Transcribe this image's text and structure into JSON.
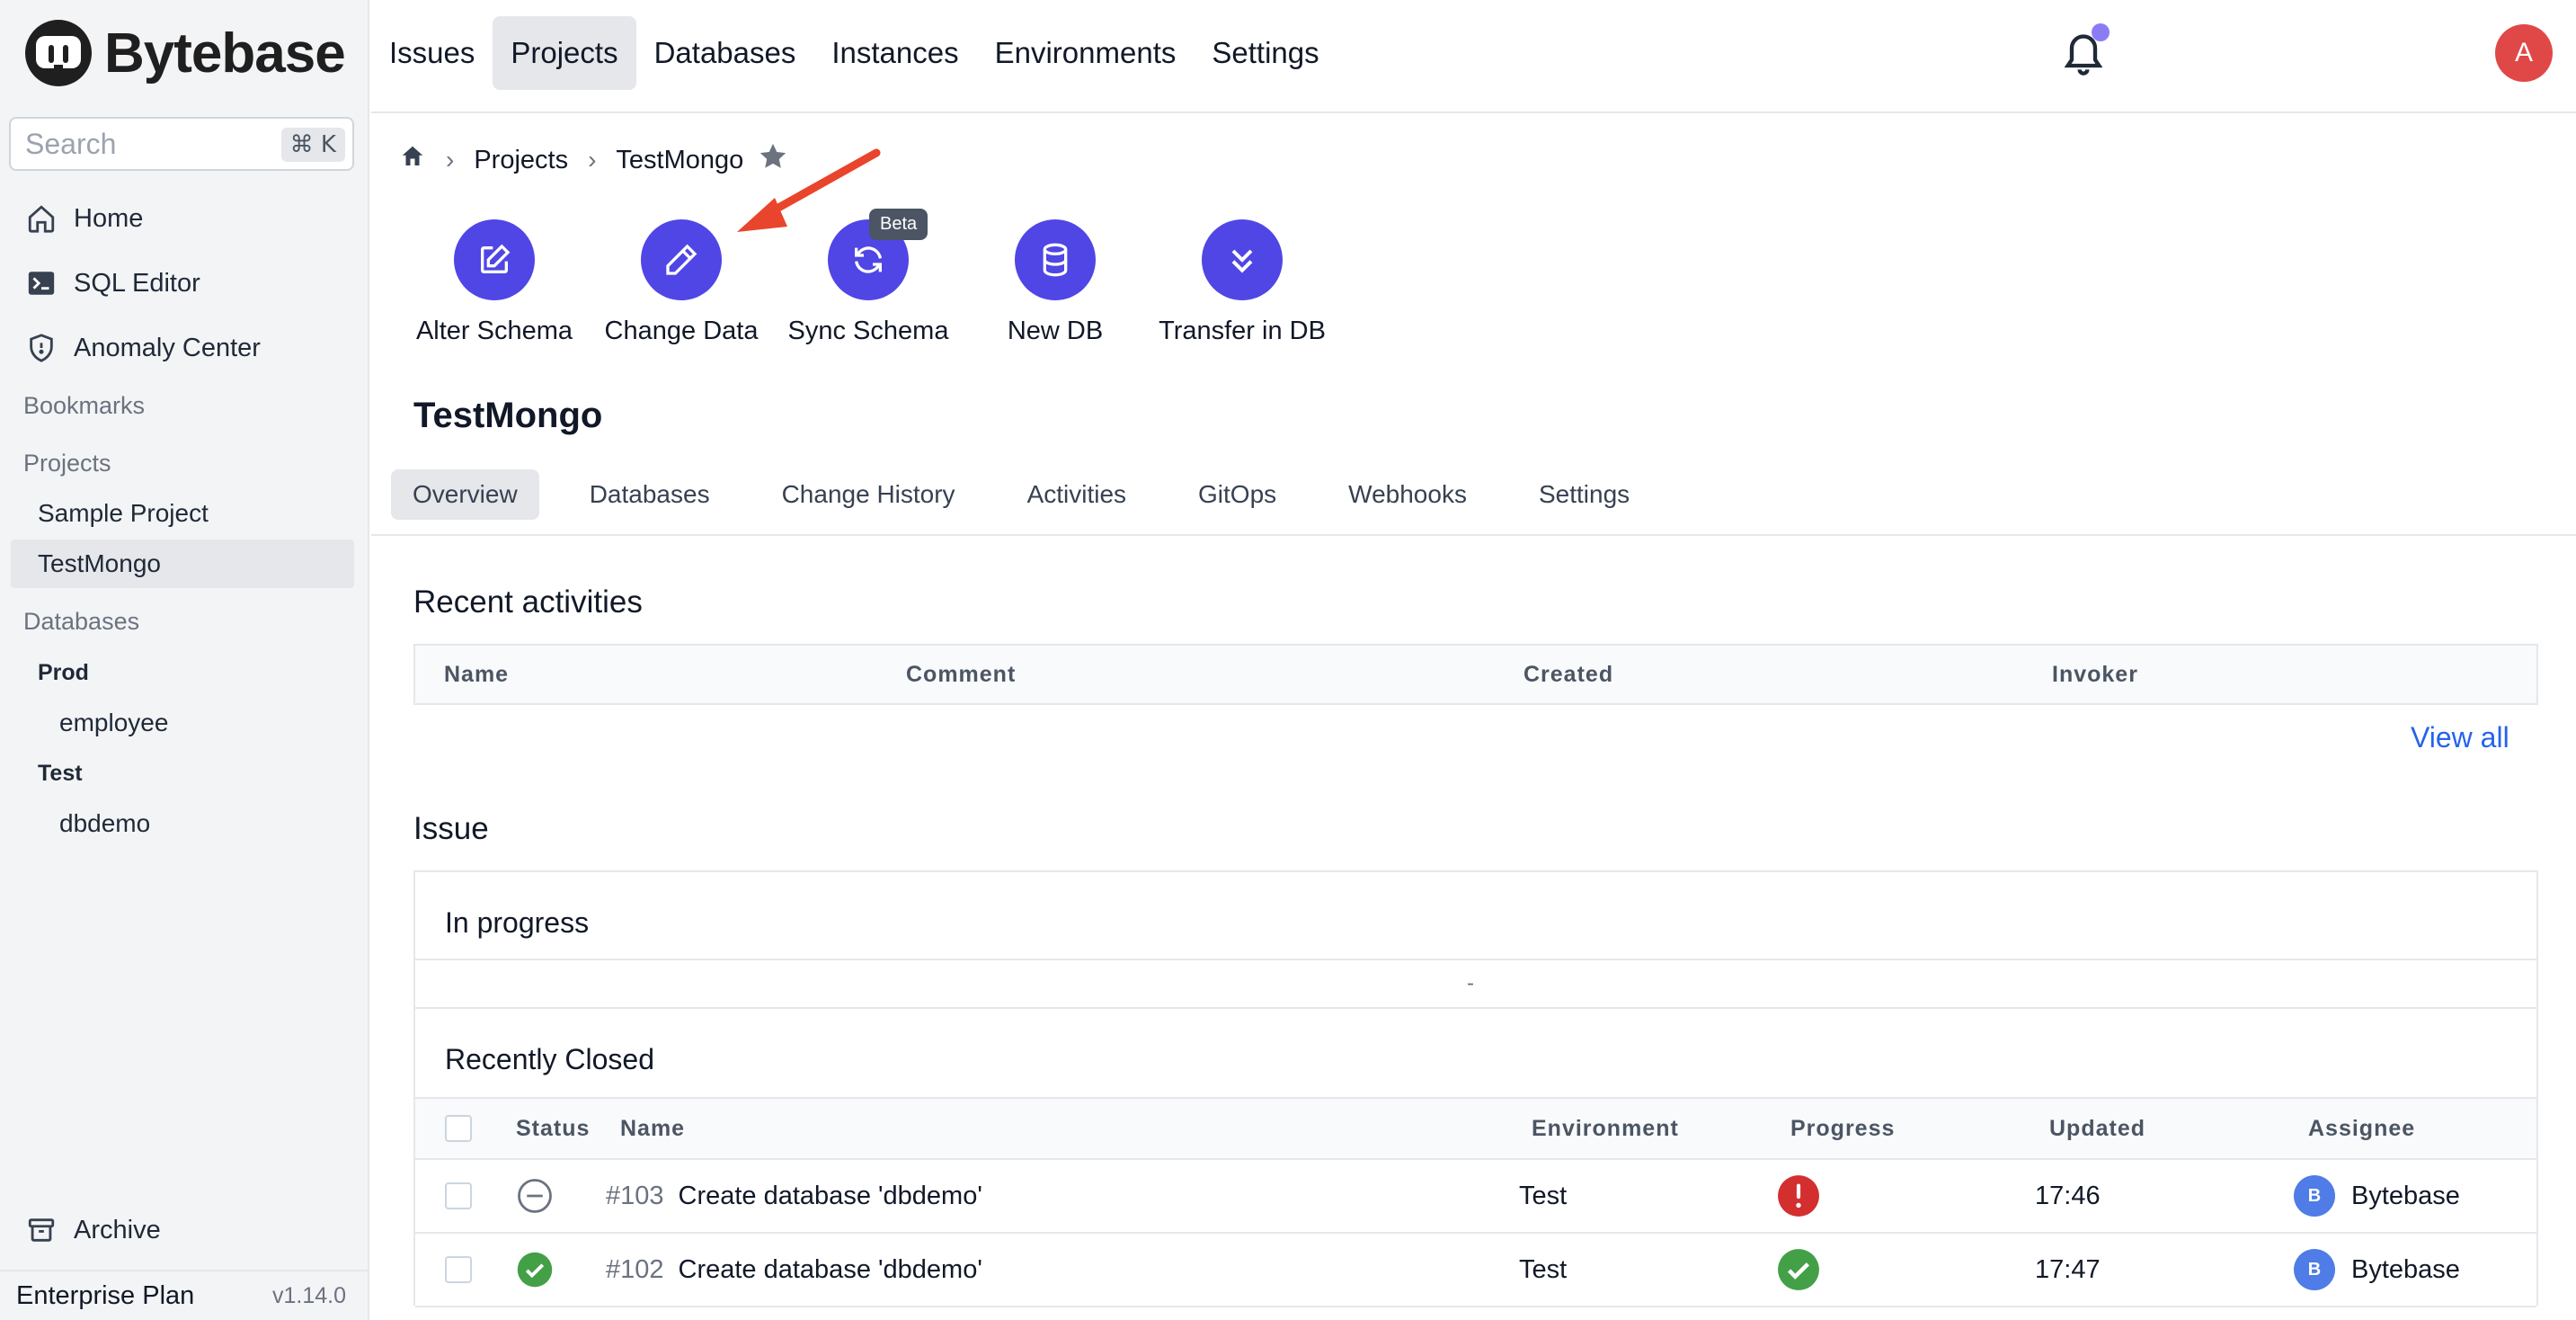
{
  "app": {
    "name": "Bytebase",
    "plan": "Enterprise Plan",
    "version": "v1.14.0"
  },
  "search": {
    "placeholder": "Search",
    "shortcut": "⌘ K"
  },
  "sidebar": {
    "nav": [
      {
        "label": "Home",
        "icon": "home-icon"
      },
      {
        "label": "SQL Editor",
        "icon": "terminal-icon"
      },
      {
        "label": "Anomaly Center",
        "icon": "shield-icon"
      }
    ],
    "bookmarks_label": "Bookmarks",
    "projects_label": "Projects",
    "projects": [
      {
        "label": "Sample Project",
        "active": false
      },
      {
        "label": "TestMongo",
        "active": true
      }
    ],
    "databases_label": "Databases",
    "environments": [
      {
        "label": "Prod",
        "databases": [
          "employee"
        ]
      },
      {
        "label": "Test",
        "databases": [
          "dbdemo"
        ]
      }
    ],
    "archive_label": "Archive"
  },
  "header": {
    "nav": [
      "Issues",
      "Projects",
      "Databases",
      "Instances",
      "Environments",
      "Settings"
    ],
    "active_nav": "Projects",
    "avatar_initial": "A"
  },
  "breadcrumb": [
    "Projects",
    "TestMongo"
  ],
  "quick_actions": [
    {
      "label": "Alter Schema",
      "icon": "edit-square-icon"
    },
    {
      "label": "Change Data",
      "icon": "pencil-icon"
    },
    {
      "label": "Sync Schema",
      "icon": "sync-icon",
      "badge": "Beta"
    },
    {
      "label": "New DB",
      "icon": "database-icon"
    },
    {
      "label": "Transfer in DB",
      "icon": "chevrons-down-icon"
    }
  ],
  "project": {
    "title": "TestMongo",
    "tabs": [
      "Overview",
      "Databases",
      "Change History",
      "Activities",
      "GitOps",
      "Webhooks",
      "Settings"
    ],
    "active_tab": "Overview"
  },
  "recent_activities": {
    "title": "Recent activities",
    "columns": [
      "Name",
      "Comment",
      "Created",
      "Invoker"
    ],
    "view_all": "View all"
  },
  "issue": {
    "title": "Issue",
    "in_progress_title": "In progress",
    "in_progress_empty": "-",
    "recently_closed_title": "Recently Closed",
    "columns": [
      "Status",
      "Name",
      "Environment",
      "Progress",
      "Updated",
      "Assignee"
    ],
    "rows": [
      {
        "id": "#103",
        "name": "Create database 'dbdemo'",
        "status": "canceled",
        "environment": "Test",
        "progress": "error",
        "updated": "17:46",
        "assignee": "Bytebase",
        "assignee_initial": "B"
      },
      {
        "id": "#102",
        "name": "Create database 'dbdemo'",
        "status": "done",
        "environment": "Test",
        "progress": "done",
        "updated": "17:47",
        "assignee": "Bytebase",
        "assignee_initial": "B"
      }
    ]
  },
  "colors": {
    "accent": "#4f46e5",
    "link": "#2563eb",
    "error": "#d32f2f",
    "success": "#43a047",
    "annotation_arrow": "#e8452c"
  }
}
